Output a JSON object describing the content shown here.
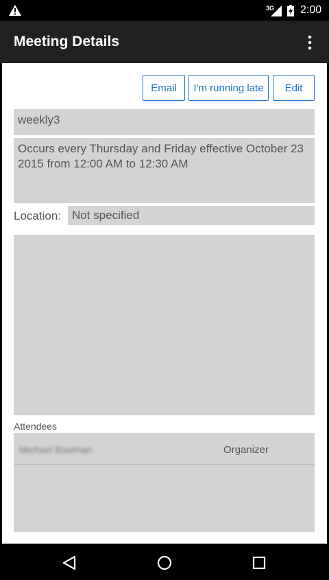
{
  "status_bar": {
    "network": "3G",
    "time": "2:00"
  },
  "app_bar": {
    "title": "Meeting Details"
  },
  "actions": {
    "email": "Email",
    "running_late": "I'm running late",
    "edit": "Edit"
  },
  "meeting": {
    "subject": "weekly3",
    "recurrence": "Occurs every Thursday and Friday effective October 23 2015 from 12:00 AM to 12:30 AM",
    "location_label": "Location:",
    "location_value": "Not specified",
    "notes": ""
  },
  "attendees": {
    "header": "Attendees",
    "rows": [
      {
        "name": "Michael Bowman",
        "role": "Organizer"
      }
    ]
  },
  "icons": {
    "status": [
      "warning-icon",
      "signal-icon",
      "battery-icon"
    ],
    "app_bar": [
      "more-vert-icon"
    ],
    "nav": [
      "back-icon",
      "home-icon",
      "recents-icon"
    ]
  }
}
